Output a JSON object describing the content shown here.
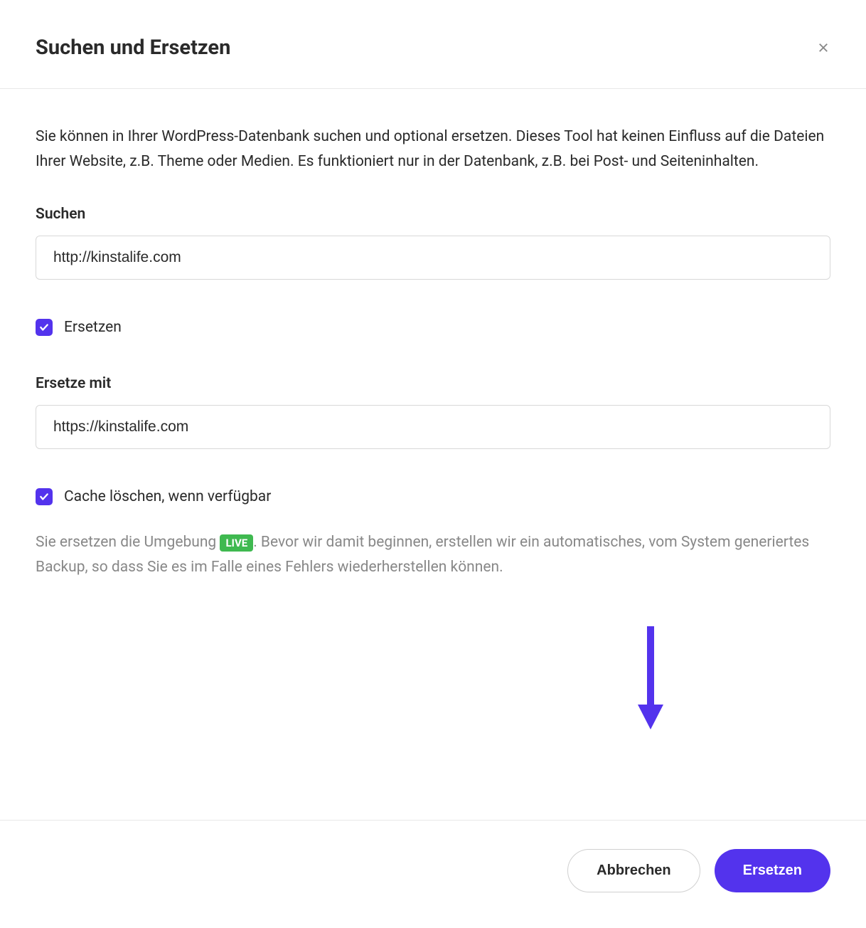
{
  "header": {
    "title": "Suchen und Ersetzen"
  },
  "body": {
    "description": "Sie können in Ihrer WordPress-Datenbank suchen und optional ersetzen. Dieses Tool hat keinen Einfluss auf die Dateien Ihrer Website, z.B. Theme oder Medien. Es funktioniert nur in der Datenbank, z.B. bei Post- und Seiteninhalten.",
    "search": {
      "label": "Suchen",
      "value": "http://kinstalife.com"
    },
    "replace_checkbox": {
      "label": "Ersetzen",
      "checked": true
    },
    "replace": {
      "label": "Ersetze mit",
      "value": "https://kinstalife.com"
    },
    "cache_checkbox": {
      "label": "Cache löschen, wenn verfügbar",
      "checked": true
    },
    "info": {
      "prefix": "Sie ersetzen die Umgebung ",
      "badge": "LIVE",
      "suffix": ". Bevor wir damit beginnen, erstellen wir ein automatisches, vom System generiertes Backup, so dass Sie es im Falle eines Fehlers wiederherstellen können."
    }
  },
  "footer": {
    "cancel_label": "Abbrechen",
    "submit_label": "Ersetzen"
  }
}
